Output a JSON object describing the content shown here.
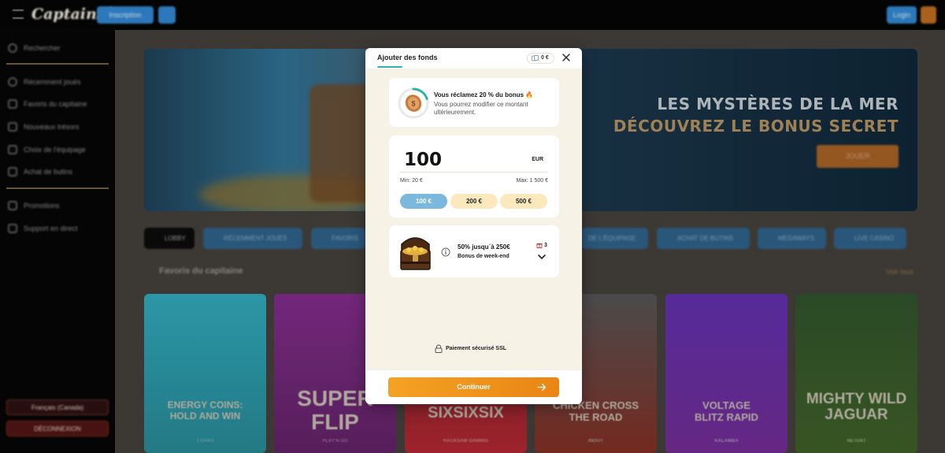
{
  "app": {
    "logo_text": "CaptainSlots",
    "top_register": "Inscription",
    "top_button_short": "",
    "top_right_button": "Login"
  },
  "sidebar": {
    "search": "Rechercher",
    "items": [
      {
        "label": "Récemment joués",
        "icon": "clock-icon"
      },
      {
        "label": "Favoris du capitaine",
        "icon": "heart-icon"
      },
      {
        "label": "Nouveaux trésors",
        "icon": "sparkle-icon"
      },
      {
        "label": "Choix de l'équipage",
        "icon": "crew-icon"
      },
      {
        "label": "Achat de butins",
        "icon": "bag-icon"
      }
    ],
    "items2": [
      {
        "label": "Promotions",
        "icon": "gift-icon"
      },
      {
        "label": "Support en direct",
        "icon": "chat-icon"
      }
    ],
    "language_btn": "Français (Canada)",
    "logout_btn": "DÉCONNEXION"
  },
  "banner": {
    "line1": "LES MYSTÈRES DE LA MER",
    "line2": "DÉCOUVREZ LE BONUS SECRET",
    "cta": "JOUER"
  },
  "filters": {
    "lobby": "LOBBY",
    "recent": "RÉCEMMENT JOUÉS",
    "favoris": "FAVORIS",
    "equipage": "DE L'ÉQUIPAGE",
    "butins": "ACHAT DE BUTINS",
    "megaways": "MEGAWAYS",
    "live": "LIVE CASINO"
  },
  "section": {
    "title": "Favoris du capitaine",
    "see_all": "Voir tous"
  },
  "games": [
    {
      "title": "ENERGY COINS: HOLD AND WIN",
      "provider": "3 OAKS",
      "color": "#2f9fb0"
    },
    {
      "title": "SUPER FLIP",
      "provider": "PLAY'N GO",
      "color": "#8d2f7a"
    },
    {
      "title": "SIXSIXSIX",
      "provider": "HACKSAW GAMING",
      "color": "#b0232e"
    },
    {
      "title": "CHICKEN CROSS THE ROAD",
      "provider": "INOUT",
      "color": "#5a5a5a"
    },
    {
      "title": "VOLTAGE BLITZ RAPID",
      "provider": "KALAMBA",
      "color": "#5a2ea3"
    },
    {
      "title": "MIGHTY WILD JAGUAR",
      "provider": "NETENT",
      "color": "#2d5e2a"
    }
  ],
  "modal": {
    "title": "Ajouter des fonds",
    "balance": "0 €",
    "bonus_title": "Vous réclamez 20 % du bonus",
    "bonus_percent": 20,
    "bonus_desc": "Vous pourrez modifier ce montant ultérieurement.",
    "amount": "100",
    "currency": "EUR",
    "min": "Min: 20 €",
    "max": "Max: 1 500 €",
    "presets": [
      "100 €",
      "200 €",
      "500 €"
    ],
    "selected_preset": 0,
    "offer_title": "50% jusqu`à 250€",
    "offer_subtitle": "Bonus de week-end",
    "offer_count": "3",
    "secure_text": "Paiement sécurisé SSL",
    "continue": "Continuer"
  },
  "colors": {
    "accent_orange": "#f09620",
    "accent_teal": "#2fb3b0",
    "preset_active": "#7ab8dd",
    "preset_idle": "#fbe8bd",
    "modal_bg": "#f6f3e6"
  }
}
